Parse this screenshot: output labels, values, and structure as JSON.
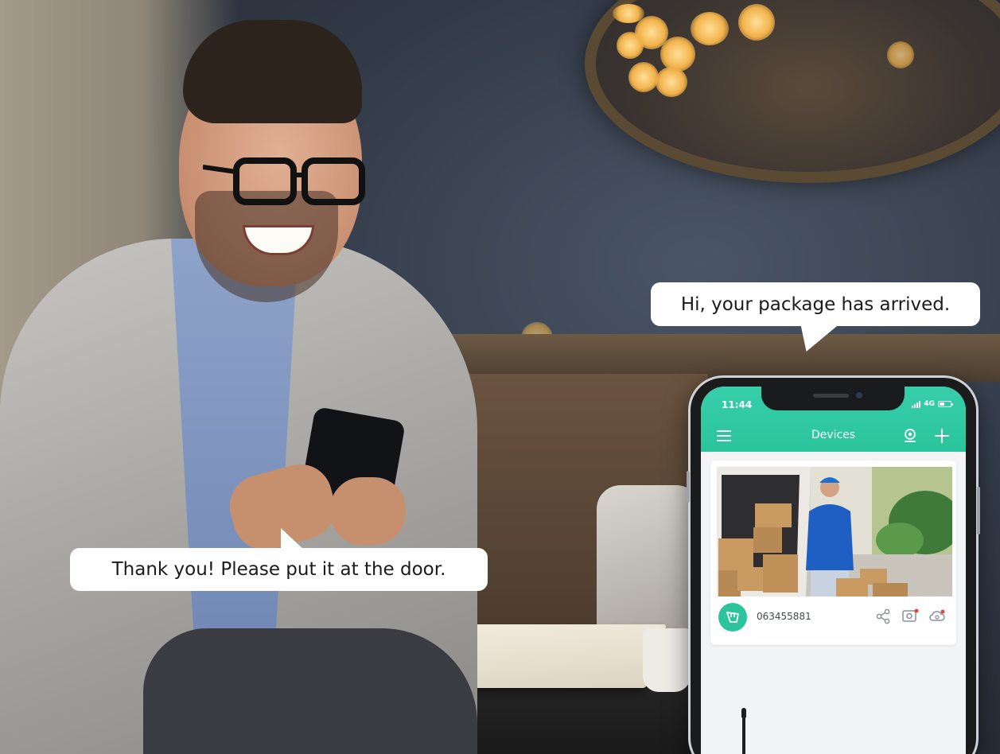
{
  "speech": {
    "customer": "Thank you! Please put it at the door.",
    "courier": "Hi, your package has arrived."
  },
  "phone": {
    "status": {
      "time": "11:44",
      "network": "4G"
    },
    "appbar": {
      "title": "Devices",
      "menu_icon": "hamburger-menu-icon",
      "locate_icon": "location-pin-icon",
      "add_icon": "plus-icon"
    },
    "device_card": {
      "device_id": "063455881",
      "avatar_icon": "camera-device-icon",
      "actions": [
        "share-icon",
        "playback-icon",
        "cloud-icon"
      ]
    }
  },
  "colors": {
    "accent": "#2cc49d",
    "bubble": "#ffffff",
    "bokeh": "#f2b24a"
  }
}
